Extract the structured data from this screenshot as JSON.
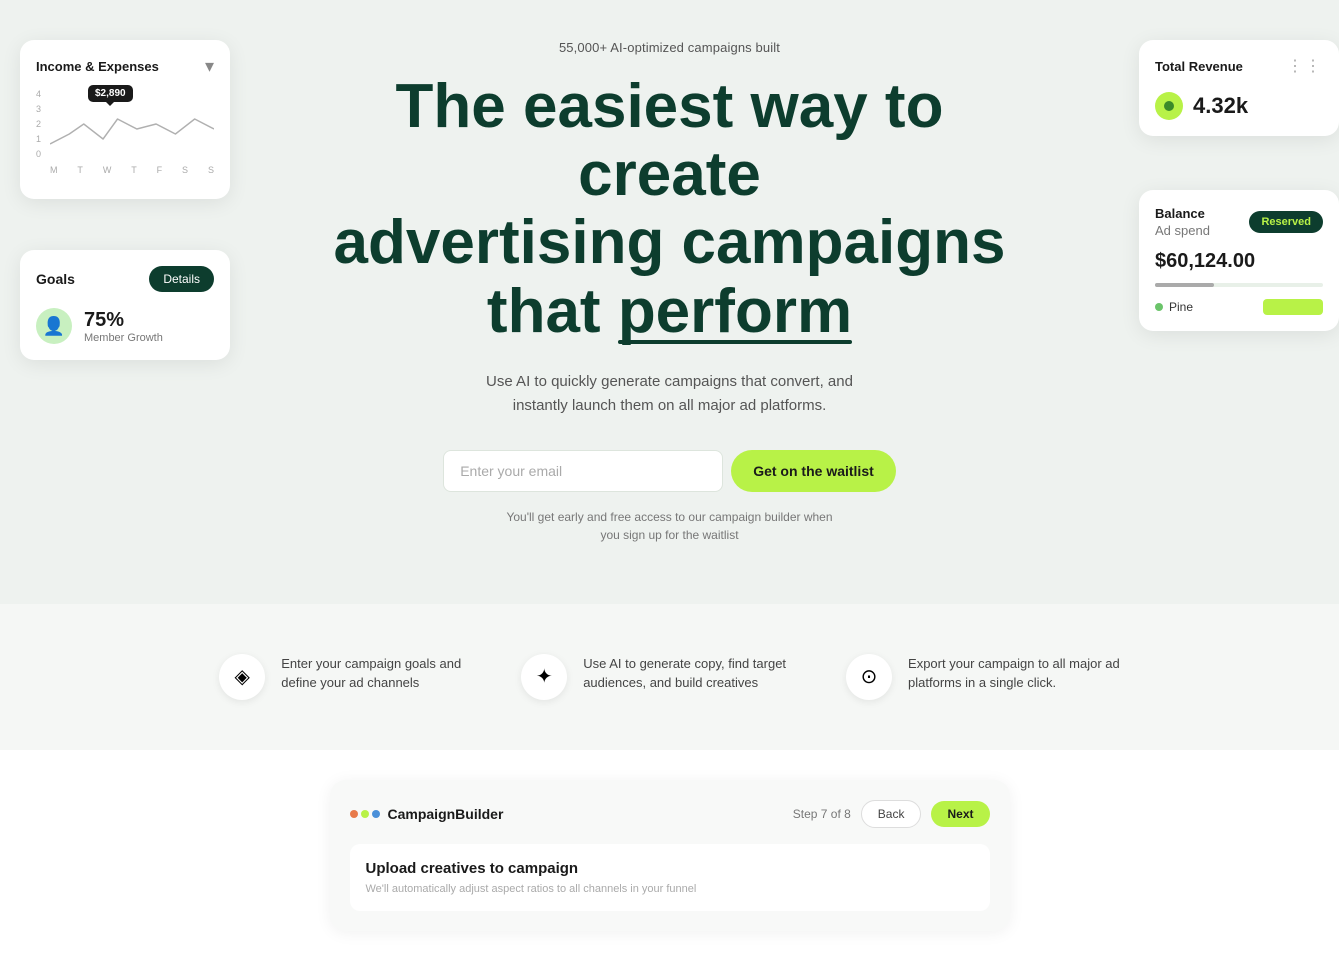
{
  "hero": {
    "subtitle": "55,000+ AI-optimized campaigns built",
    "title_line1": "The easiest way to create",
    "title_line2": "advertising campaigns that",
    "title_highlight": "perform",
    "description_line1": "Use AI to quickly generate campaigns that convert, and",
    "description_line2": "instantly launch them on all major ad platforms.",
    "email_placeholder": "Enter your email",
    "waitlist_btn": "Get on the waitlist",
    "note_line1": "You'll get early and free access to our campaign builder when",
    "note_line2": "you sign up for the waitlist"
  },
  "income_card": {
    "title": "Income & Expenses",
    "tooltip": "$2,890",
    "y_labels": [
      "4",
      "3",
      "2",
      "1",
      "0"
    ],
    "x_labels": [
      "M",
      "T",
      "W",
      "T",
      "F",
      "S",
      "S"
    ]
  },
  "goals_card": {
    "title": "Goals",
    "details_btn": "Details",
    "percent": "75%",
    "label": "Member Growth"
  },
  "revenue_card": {
    "title": "Total Revenue",
    "amount": "4.32k",
    "dots": "⋮"
  },
  "balance_card": {
    "label1": "Balance",
    "label2": "Ad spend",
    "badge": "Reserved",
    "amount": "$60,124.00",
    "tag": "Pine"
  },
  "features": [
    {
      "icon": "◈",
      "text_line1": "Enter your campaign goals and",
      "text_line2": "define your ad channels"
    },
    {
      "icon": "✦",
      "text_line1": "Use AI to generate copy, find target",
      "text_line2": "audiences, and build creatives"
    },
    {
      "icon": "⊙",
      "text_line1": "Export your campaign to all major ad",
      "text_line2": "platforms in a single click."
    }
  ],
  "campaign_builder": {
    "logo_text": "CampaignBuilder",
    "step": "Step 7 of 8",
    "back_btn": "Back",
    "next_btn": "Next",
    "content_title": "Upload creatives to campaign",
    "content_subtitle": "We'll automatically adjust aspect ratios to all channels in your funnel"
  },
  "colors": {
    "accent_green": "#b8f247",
    "dark_green": "#0d3d2e",
    "bg": "#eef2ef"
  }
}
